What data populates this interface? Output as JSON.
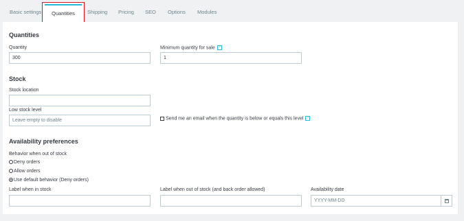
{
  "tabs": [
    {
      "label": "Basic settings"
    },
    {
      "label": "Quantities"
    },
    {
      "label": "Shipping"
    },
    {
      "label": "Pricing"
    },
    {
      "label": "SEO"
    },
    {
      "label": "Options"
    },
    {
      "label": "Modules"
    }
  ],
  "active_tab": "Quantities",
  "quantities": {
    "heading": "Quantities",
    "quantity_label": "Quantity",
    "quantity_value": "300",
    "min_qty_label": "Minimum quantity for sale",
    "min_qty_value": "1",
    "help_glyph": "?"
  },
  "stock": {
    "heading": "Stock",
    "location_label": "Stock location",
    "location_value": "",
    "low_stock_label": "Low stock level",
    "low_stock_placeholder": "Leave empty to disable",
    "email_checkbox_label": "Send me an email when the quantity is below or equals this level",
    "email_checked": false
  },
  "availability": {
    "heading": "Availability preferences",
    "behavior_label": "Behavior when out of stock",
    "options": [
      {
        "label": "Deny orders",
        "selected": false
      },
      {
        "label": "Allow orders",
        "selected": false
      },
      {
        "label": "Use default behavior (Deny orders)",
        "selected": true
      }
    ],
    "in_stock_label": "Label when in stock",
    "out_stock_label": "Label when out of stock (and back order allowed)",
    "date_label": "Availability date",
    "date_placeholder": "YYYY-MM-DD"
  },
  "colors": {
    "accent": "#25b9d7",
    "highlight_border": "#e1121b"
  }
}
